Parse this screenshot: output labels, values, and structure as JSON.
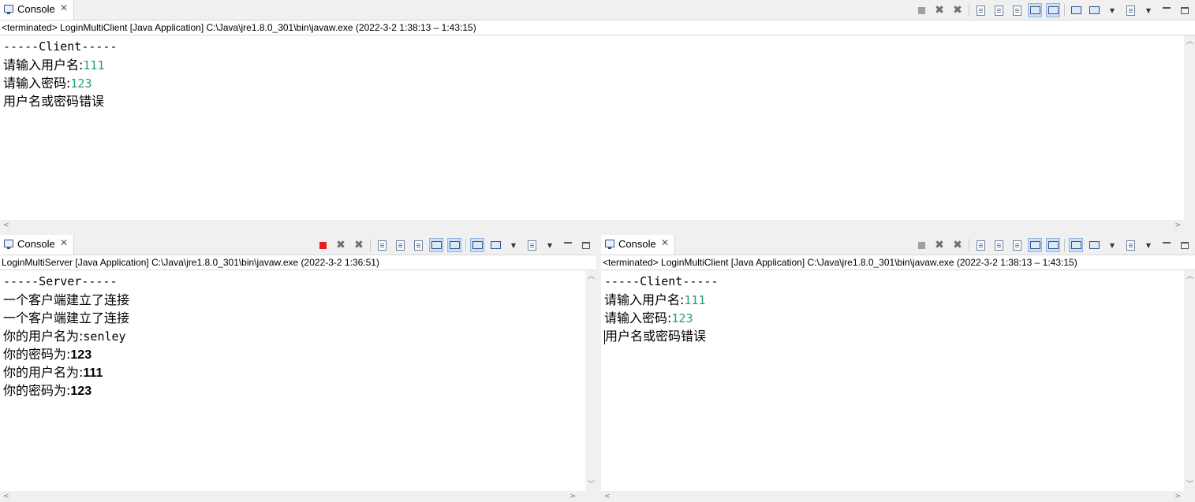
{
  "top": {
    "tab_label": "Console",
    "description": "<terminated> LoginMultiClient [Java Application] C:\\Java\\jre1.8.0_301\\bin\\javaw.exe  (2022-3-2 1:38:13 – 1:43:15)",
    "lines": {
      "l1": "-----Client-----",
      "l2_prompt": "请输入用户名:",
      "l2_input": "111",
      "l3_prompt": "请输入密码:",
      "l3_input": "123",
      "l4": "用户名或密码错误"
    }
  },
  "left": {
    "tab_label": "Console",
    "description": "LoginMultiServer [Java Application] C:\\Java\\jre1.8.0_301\\bin\\javaw.exe  (2022-3-2 1:36:51)",
    "lines": {
      "l1": "-----Server-----",
      "l2": "一个客户端建立了连接",
      "l3": "一个客户端建立了连接",
      "l4_label": "你的用户名为:",
      "l4_value": "senley",
      "l5_label": "你的密码为:",
      "l5_value": "123",
      "l6_label": "你的用户名为:",
      "l6_value": "111",
      "l7_label": "你的密码为:",
      "l7_value": "123"
    }
  },
  "right": {
    "tab_label": "Console",
    "description": "<terminated> LoginMultiClient [Java Application] C:\\Java\\jre1.8.0_301\\bin\\javaw.exe  (2022-3-2 1:38:13 – 1:43:15)",
    "lines": {
      "l1": "-----Client-----",
      "l2_prompt": "请输入用户名:",
      "l2_input": "111",
      "l3_prompt": "请输入密码:",
      "l3_input": "123",
      "l4": "用户名或密码错误"
    }
  },
  "colors": {
    "input_text": "#1f9e7e",
    "terminate_active": "#e81d1d",
    "toggle_active_bg": "#c9e0f7"
  },
  "icons": {
    "tab": "console-icon",
    "close": "close-tab-icon"
  }
}
